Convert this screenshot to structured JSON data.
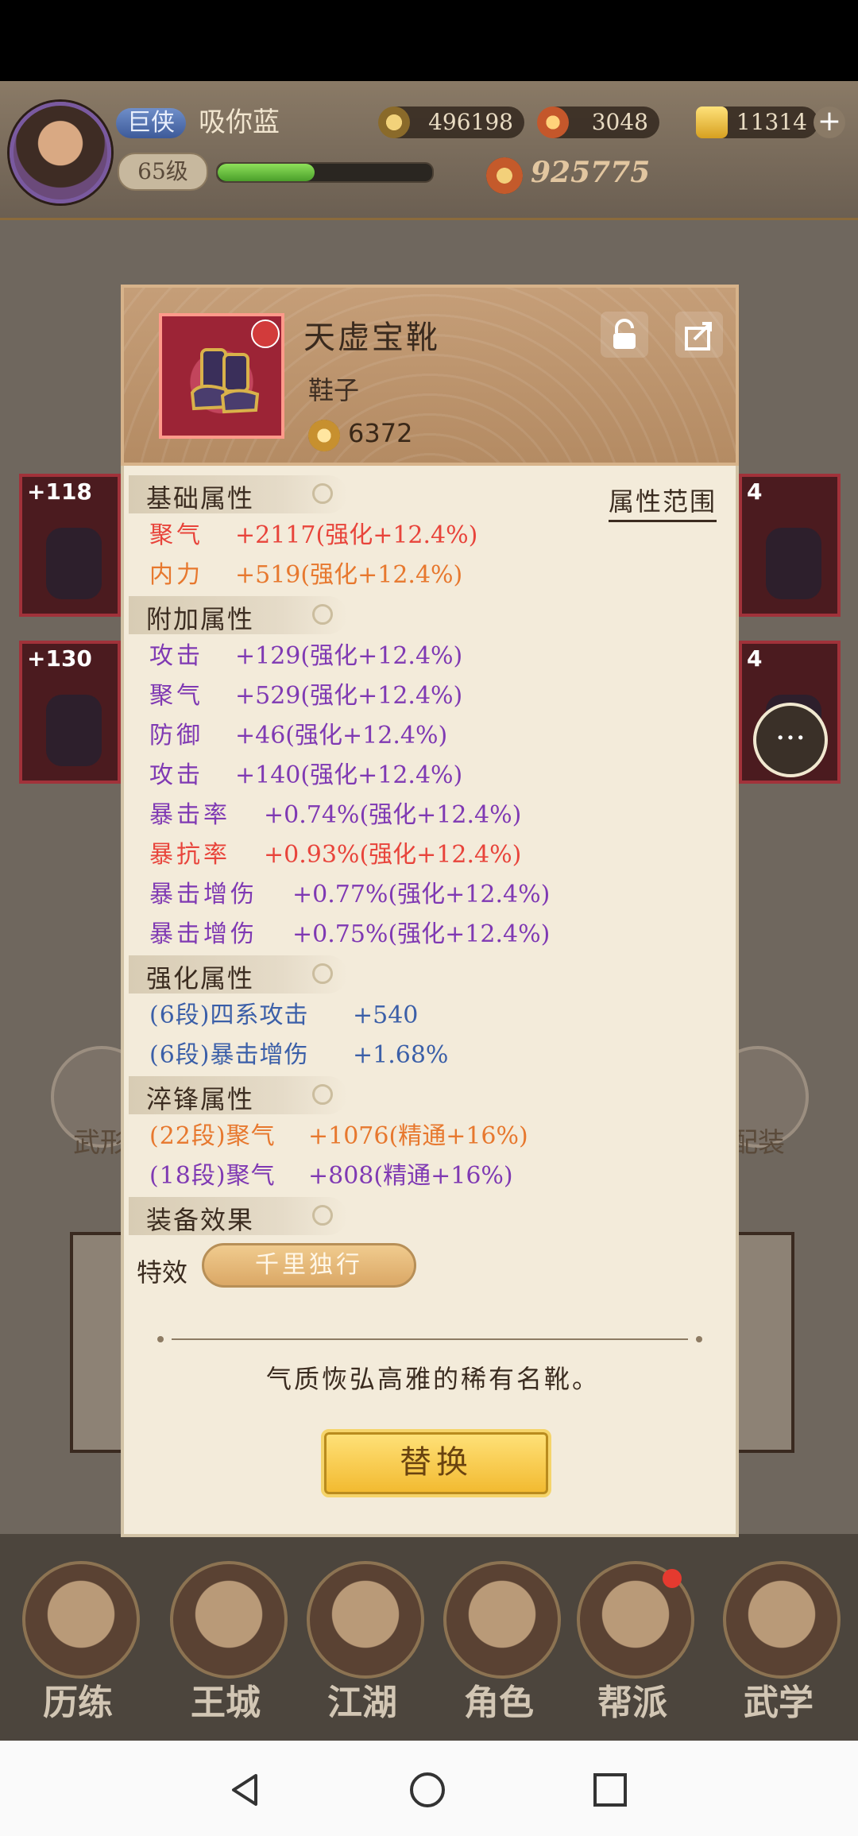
{
  "header": {
    "title_badge": "巨侠",
    "player_name": "吸你蓝",
    "level": "65级",
    "exp_progress": 0.45,
    "silver": "496198",
    "energy": "3048",
    "gold": "11314",
    "power": "925775"
  },
  "slots": {
    "left_1": "+118",
    "left_2": "+130",
    "right_1": "4",
    "right_2": "4"
  },
  "side": {
    "left_label": "武形",
    "right_label": "配装"
  },
  "item": {
    "name": "天虚宝靴",
    "type": "鞋子",
    "score": "6372",
    "range_link": "属性范围"
  },
  "sections": {
    "base": "基础属性",
    "extra": "附加属性",
    "enhance": "强化属性",
    "temper": "淬锋属性",
    "effect": "装备效果"
  },
  "base_attrs": [
    {
      "name": "聚气",
      "value": "+2117(强化+12.4%)",
      "color": "#e8443b"
    },
    {
      "name": "内力",
      "value": "+519(强化+12.4%)",
      "color": "#e7782e"
    }
  ],
  "extra_attrs": [
    {
      "name": "攻击",
      "value": "+129(强化+12.4%)",
      "color": "#7f39b3"
    },
    {
      "name": "聚气",
      "value": "+529(强化+12.4%)",
      "color": "#7f39b3"
    },
    {
      "name": "防御",
      "value": "+46(强化+12.4%)",
      "color": "#7f39b3"
    },
    {
      "name": "攻击",
      "value": "+140(强化+12.4%)",
      "color": "#7f39b3"
    },
    {
      "name": "暴击率",
      "value": "+0.74%(强化+12.4%)",
      "color": "#7f39b3"
    },
    {
      "name": "暴抗率",
      "value": "+0.93%(强化+12.4%)",
      "color": "#e8443b"
    },
    {
      "name": "暴击增伤",
      "value": "+0.77%(强化+12.4%)",
      "color": "#7f39b3"
    },
    {
      "name": "暴击增伤",
      "value": "+0.75%(强化+12.4%)",
      "color": "#7f39b3"
    }
  ],
  "enhance_attrs": [
    {
      "name": "(6段)四系攻击",
      "value": "+540",
      "color": "#3b5fa8"
    },
    {
      "name": "(6段)暴击增伤",
      "value": "+1.68%",
      "color": "#3b5fa8"
    }
  ],
  "temper_attrs": [
    {
      "name": "(22段)聚气",
      "value": "+1076(精通+16%)",
      "color": "#e7782e"
    },
    {
      "name": "(18段)聚气",
      "value": "+808(精通+16%)",
      "color": "#7f39b3"
    }
  ],
  "effect": {
    "label": "特效",
    "tag": "千里独行"
  },
  "description": "气质恢弘高雅的稀有名靴。",
  "replace_button": "替换",
  "nav": [
    "历练",
    "王城",
    "江湖",
    "角色",
    "帮派",
    "武学"
  ],
  "icons": {
    "lock": "unlock-icon",
    "share": "share-icon",
    "chat": "chat-icon"
  }
}
